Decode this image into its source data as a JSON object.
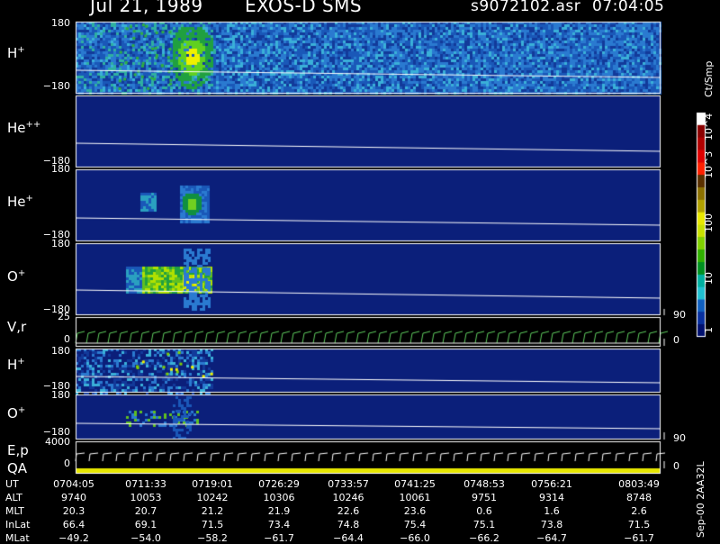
{
  "header": {
    "date": "Jul 21, 1989",
    "instrument": "EXOS-D SMS",
    "file": "s9072102.asr",
    "start_time": "07:04:05"
  },
  "colorbar": {
    "unit": "Ct/Smp",
    "labels": [
      "10^4",
      "10^3",
      "100",
      "10",
      "1"
    ],
    "colors": [
      "#ffffff",
      "#8b0000",
      "#b00000",
      "#e00000",
      "#ff2000",
      "#5a3000",
      "#8b7000",
      "#b0a000",
      "#e8e800",
      "#c8e000",
      "#80d000",
      "#30b000",
      "#009020",
      "#00b0a0",
      "#20c0d0",
      "#1060c0",
      "#0830a0",
      "#001070"
    ]
  },
  "footer_side": {
    "version": "Sep-00",
    "code": "2AA32L"
  },
  "chart_data": {
    "type": "heatmap",
    "panels": [
      {
        "id": "h-plus",
        "label": "H",
        "charge": "+",
        "ymax": "180",
        "ymin": "−180",
        "right_tick": ""
      },
      {
        "id": "he-plus-plus",
        "label": "He",
        "charge": "++",
        "ymax": "",
        "ymin": "−180",
        "right_tick": ""
      },
      {
        "id": "he-plus",
        "label": "He",
        "charge": "+",
        "ymax": "180",
        "ymin": "−180",
        "right_tick": ""
      },
      {
        "id": "o-plus",
        "label": "O",
        "charge": "+",
        "ymax": "180",
        "ymin": "−180",
        "right_tick": "90"
      },
      {
        "id": "vr",
        "label": "V,r",
        "charge": "",
        "ymax": "25",
        "ymin": "0",
        "right_tick": "0"
      },
      {
        "id": "h-plus-2",
        "label": "H",
        "charge": "+",
        "ymax": "180",
        "ymin": "−180",
        "right_tick": ""
      },
      {
        "id": "o-plus-2",
        "label": "O",
        "charge": "+",
        "ymax": "180",
        "ymin": "−180",
        "right_tick": "90"
      },
      {
        "id": "ep",
        "label": "E,p",
        "charge": "",
        "ymax": "4000",
        "ymin": "0",
        "right_tick": "0"
      }
    ],
    "qa_label": "QA",
    "x_rows": {
      "UT": [
        "0704:05",
        "0711:33",
        "0719:01",
        "0726:29",
        "0733:57",
        "0741:25",
        "0748:53",
        "0756:21",
        "0803:49"
      ],
      "ALT": [
        "9740",
        "10053",
        "10242",
        "10306",
        "10246",
        "10061",
        "9751",
        "9314",
        "8748"
      ],
      "MLT": [
        "20.3",
        "20.7",
        "21.2",
        "21.9",
        "22.6",
        "23.6",
        "0.6",
        "1.6",
        "2.6"
      ],
      "InvLat": [
        "66.4",
        "69.1",
        "71.5",
        "73.4",
        "74.8",
        "75.4",
        "75.1",
        "73.8",
        "71.5"
      ],
      "MLat": [
        "−49.2",
        "−54.0",
        "−58.2",
        "−61.7",
        "−64.4",
        "−66.0",
        "−66.2",
        "−64.7",
        "−61.7"
      ]
    },
    "x_row_labels": [
      "UT",
      "ALT",
      "MLT",
      "InLat",
      "MLat"
    ]
  }
}
